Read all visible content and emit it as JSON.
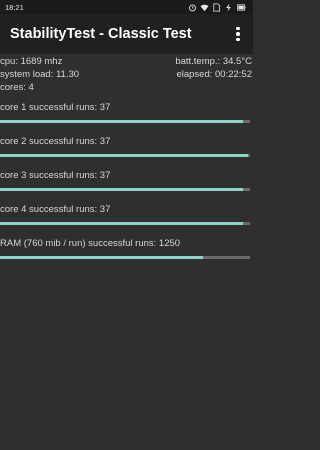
{
  "status_bar": {
    "time": "18:21",
    "icons": [
      "alarm-icon",
      "wifi-icon",
      "sim-icon",
      "charging-icon",
      "battery-icon"
    ]
  },
  "app_bar": {
    "title": "StabilityTest - Classic Test",
    "menu_icon": "more-vert-icon"
  },
  "info": {
    "cpu": "cpu: 1689 mhz",
    "batt_temp": "batt.temp.: 34.5°C",
    "system_load": "system load: 11.30",
    "elapsed": "elapsed: 00:22:52",
    "cores": "cores: 4"
  },
  "tests": [
    {
      "label": "core 1 successful runs: 37",
      "progress": 0.97
    },
    {
      "label": "core 2 successful runs: 37",
      "progress": 0.99
    },
    {
      "label": "core 3 successful runs: 37",
      "progress": 0.97
    },
    {
      "label": "core 4 successful runs: 37",
      "progress": 0.97
    },
    {
      "label": "RAM (760 mib / run) successful runs: 1250",
      "progress": 0.81
    }
  ],
  "colors": {
    "background": "#2f2f2f",
    "app_bar": "#202020",
    "accent": "#8fd3c6",
    "track": "#6a6a6a"
  }
}
